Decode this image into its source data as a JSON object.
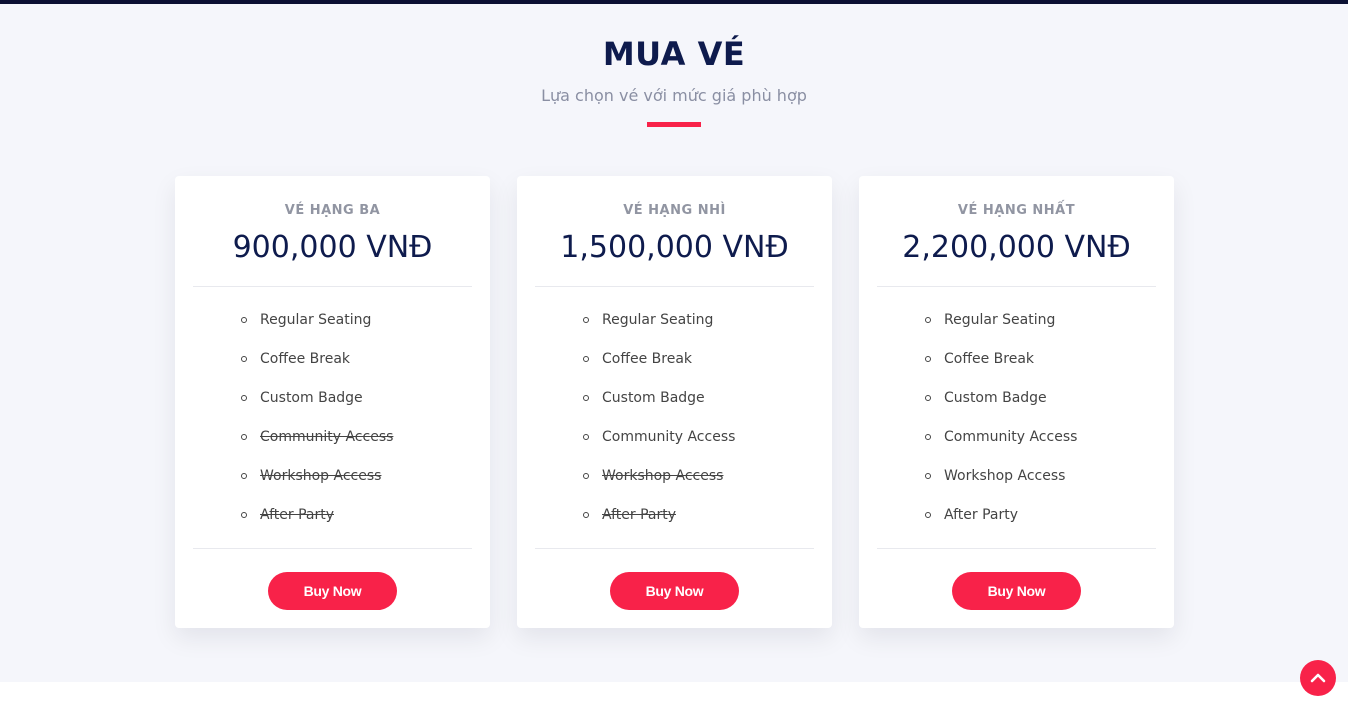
{
  "section": {
    "title": "MUA VÉ",
    "subtitle": "Lựa chọn vé với mức giá phù hợp"
  },
  "colors": {
    "accent": "#f82249",
    "heading": "#0e1b4d",
    "background": "#f5f6fb"
  },
  "tickets": [
    {
      "tier": "VÉ HẠNG BA",
      "price": "900,000 VNĐ",
      "features": [
        {
          "label": "Regular Seating",
          "included": true
        },
        {
          "label": "Coffee Break",
          "included": true
        },
        {
          "label": "Custom Badge",
          "included": true
        },
        {
          "label": "Community Access",
          "included": false
        },
        {
          "label": "Workshop Access",
          "included": false
        },
        {
          "label": "After Party",
          "included": false
        }
      ],
      "button": "Buy Now"
    },
    {
      "tier": "VÉ HẠNG NHÌ",
      "price": "1,500,000 VNĐ",
      "features": [
        {
          "label": "Regular Seating",
          "included": true
        },
        {
          "label": "Coffee Break",
          "included": true
        },
        {
          "label": "Custom Badge",
          "included": true
        },
        {
          "label": "Community Access",
          "included": true
        },
        {
          "label": "Workshop Access",
          "included": false
        },
        {
          "label": "After Party",
          "included": false
        }
      ],
      "button": "Buy Now"
    },
    {
      "tier": "VÉ HẠNG NHẤT",
      "price": "2,200,000 VNĐ",
      "features": [
        {
          "label": "Regular Seating",
          "included": true
        },
        {
          "label": "Coffee Break",
          "included": true
        },
        {
          "label": "Custom Badge",
          "included": true
        },
        {
          "label": "Community Access",
          "included": true
        },
        {
          "label": "Workshop Access",
          "included": true
        },
        {
          "label": "After Party",
          "included": true
        }
      ],
      "button": "Buy Now"
    }
  ],
  "back_to_top": {
    "icon": "chevron-up-icon"
  }
}
